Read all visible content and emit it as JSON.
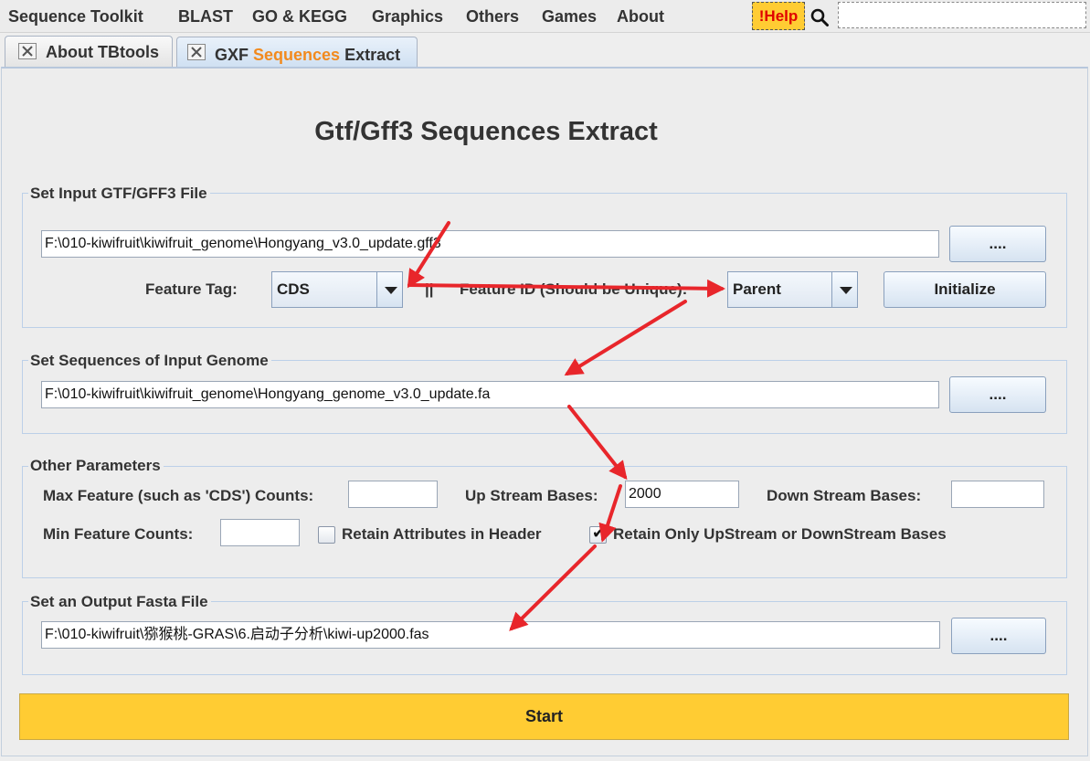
{
  "menu": {
    "items": [
      "Sequence Toolkit",
      "BLAST",
      "GO & KEGG",
      "Graphics",
      "Others",
      "Games",
      "About"
    ],
    "help_label": "!Help",
    "search_placeholder": ""
  },
  "tabs": {
    "about": {
      "label": "About TBtools"
    },
    "gxf": {
      "label_part1": "GXF ",
      "label_part2": "Sequences",
      "label_part3": " Extract"
    }
  },
  "page": {
    "title": "Gtf/Gff3 Sequences Extract"
  },
  "input_file": {
    "group_title": "Set Input GTF/GFF3 File",
    "path": "F:\\010-kiwifruit\\kiwifruit_genome\\Hongyang_v3.0_update.gff3",
    "browse_label": "....",
    "feature_tag_label": "Feature Tag:",
    "feature_tag_value": "CDS",
    "separator": "||",
    "feature_id_label": "Feature ID (Should be Unique):",
    "feature_id_value": "Parent",
    "initialize_label": "Initialize"
  },
  "genome": {
    "group_title": "Set Sequences of Input Genome",
    "path": "F:\\010-kiwifruit\\kiwifruit_genome\\Hongyang_genome_v3.0_update.fa",
    "browse_label": "...."
  },
  "params": {
    "group_title": "Other Parameters",
    "max_feature_label": "Max Feature (such as 'CDS') Counts:",
    "max_feature_value": "",
    "upstream_label": "Up Stream Bases:",
    "upstream_value": "2000",
    "downstream_label": "Down Stream Bases:",
    "downstream_value": "",
    "min_feature_label": "Min Feature Counts:",
    "min_feature_value": "",
    "retain_attr_label": "Retain Attributes in Header",
    "retain_attr_checked": false,
    "retain_up_down_label": "Retain Only UpStream or DownStream Bases",
    "retain_up_down_checked": true
  },
  "output": {
    "group_title": "Set an Output Fasta File",
    "path": "F:\\010-kiwifruit\\猕猴桃-GRAS\\6.启动子分析\\kiwi-up2000.fas",
    "browse_label": "...."
  },
  "start_label": "Start",
  "colors": {
    "accent_yellow": "#ffcc33",
    "help_text": "#e00000",
    "tab_orange": "#f28a1e",
    "annotation_arrow": "#e8262b"
  }
}
